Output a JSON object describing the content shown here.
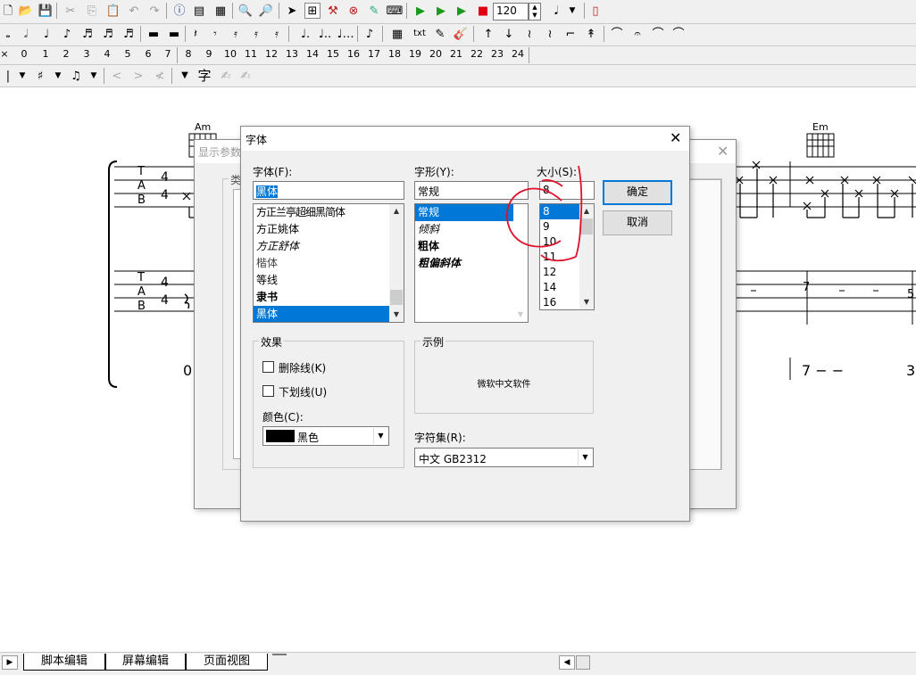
{
  "toolbar": {
    "tempo": "120",
    "numbers": [
      "0",
      "1",
      "2",
      "3",
      "4",
      "5",
      "6",
      "7",
      "8",
      "9",
      "10",
      "11",
      "12",
      "13",
      "14",
      "15",
      "16",
      "17",
      "18",
      "19",
      "20",
      "21",
      "22",
      "23",
      "24"
    ],
    "x_label": "×",
    "text_tool": "txt",
    "char_tool": "字"
  },
  "score": {
    "chords": [
      "Am",
      "Em",
      "Em"
    ],
    "tab_letters": [
      "T",
      "A",
      "B"
    ],
    "time_sig": [
      "4",
      "4"
    ],
    "row2_fret_left": "4",
    "row2_right_frets": [
      "7",
      "5"
    ],
    "jianpu_left": "0",
    "jianpu_right": "7 − −",
    "jianpu_far_right": "3"
  },
  "bg_dialog": {
    "title": "显示参数",
    "group_label": "类"
  },
  "font_dialog": {
    "title": "字体",
    "font_label": "字体(F):",
    "font_value": "黑体",
    "fonts": [
      "方正兰亭超细黑简体",
      "方正姚体",
      "方正舒体",
      "楷体",
      "等线",
      "隶书",
      "黑体"
    ],
    "style_label": "字形(Y):",
    "style_value": "常规",
    "styles": [
      "常规",
      "倾斜",
      "粗体",
      "粗偏斜体"
    ],
    "size_label": "大小(S):",
    "size_value": "8",
    "sizes": [
      "8",
      "9",
      "10",
      "11",
      "12",
      "14",
      "16"
    ],
    "ok": "确定",
    "cancel": "取消",
    "effects_label": "效果",
    "strikeout": "删除线(K)",
    "underline": "下划线(U)",
    "color_label": "颜色(C):",
    "color_value": "黑色",
    "sample_label": "示例",
    "sample_text": "微软中文软件",
    "charset_label": "字符集(R):",
    "charset_value": "中文 GB2312"
  },
  "tabs": [
    "脚本编辑",
    "屏幕编辑",
    "页面视图"
  ],
  "colors": {
    "accent": "#0078d7",
    "annotation": "#e0102a"
  }
}
